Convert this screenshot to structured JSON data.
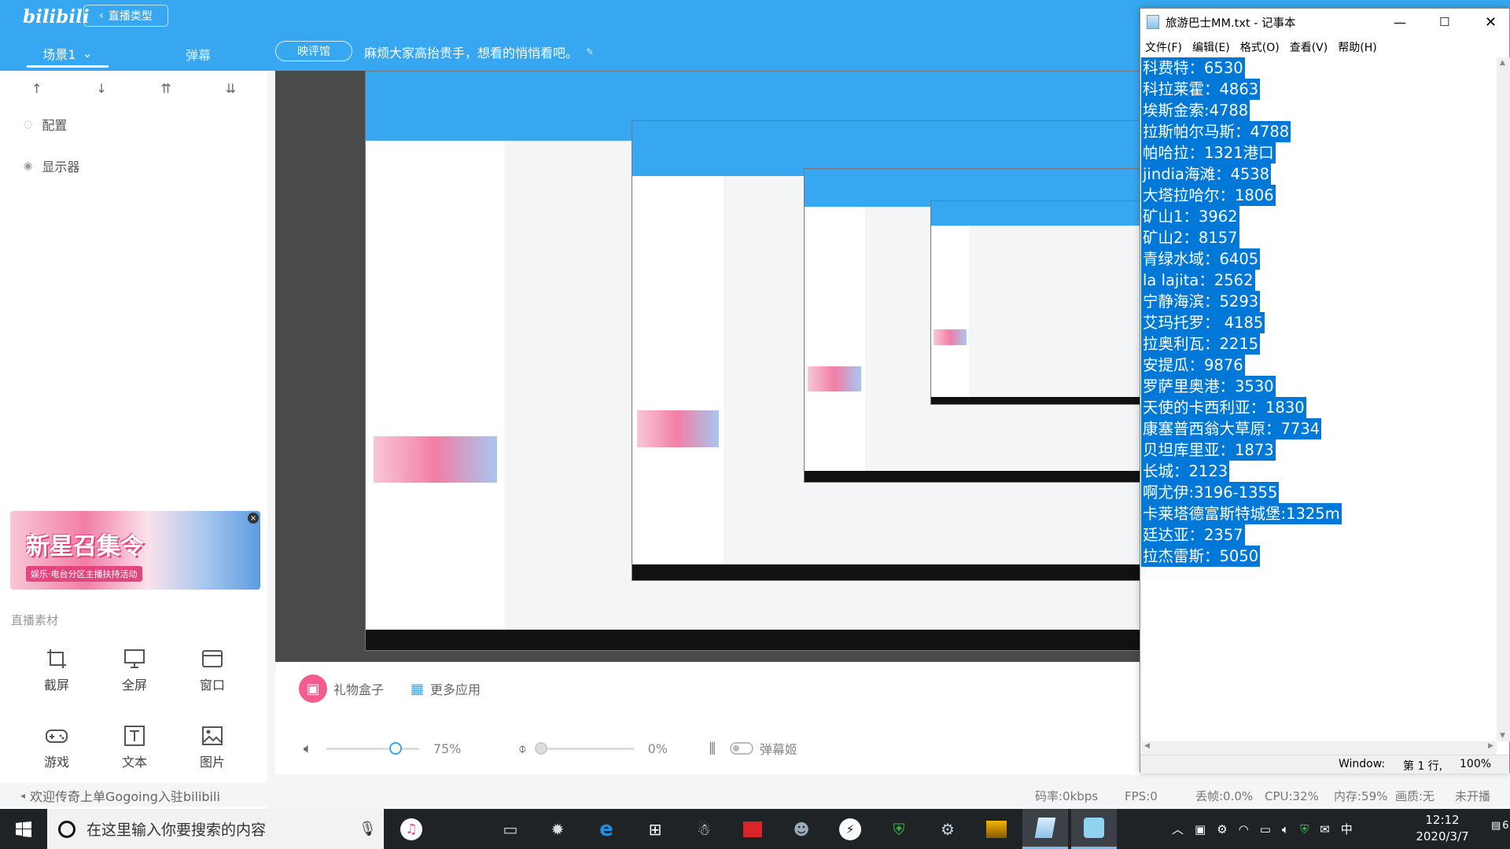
{
  "app": {
    "logo": "bilibili",
    "live_type_btn": "直播类型",
    "scene_tab": "场景1",
    "danmaku_tab": "弹幕",
    "review_btn": "映评馆",
    "notice": "麻烦大家高抬贵手，想看的悄悄看吧。"
  },
  "sidebar": {
    "items": [
      {
        "label": "配置",
        "icon": "eye-off-icon"
      },
      {
        "label": "显示器",
        "icon": "eye-icon"
      }
    ],
    "banner_title": "新星召集令",
    "banner_sub": "娱乐·电台分区主播扶持活动",
    "assets_title": "直播素材",
    "assets": [
      {
        "label": "截屏",
        "icon": "crop-icon"
      },
      {
        "label": "全屏",
        "icon": "monitor-icon"
      },
      {
        "label": "窗口",
        "icon": "window-icon"
      },
      {
        "label": "游戏",
        "icon": "gamepad-icon"
      },
      {
        "label": "文本",
        "icon": "text-icon"
      },
      {
        "label": "图片",
        "icon": "image-icon"
      }
    ]
  },
  "controls": {
    "gift_box": "礼物盒子",
    "more_apps": "更多应用",
    "volume": "75%",
    "volume_level": 0.75,
    "mic": "0%",
    "mic_level": 0.0,
    "danmaku_girl": "弹幕姬"
  },
  "statusbar": {
    "welcome": "欢迎传奇上单Gogoing入驻bilibili",
    "bitrate": "码率:0kbps",
    "fps": "FPS:0",
    "dropped": "丢帧:0.0%",
    "cpu": "CPU:32%",
    "mem": "内存:59%",
    "quality": "画质:无",
    "live_state": "未开播"
  },
  "notepad": {
    "title": "旅游巴士MM.txt - 记事本",
    "menu": [
      "文件(F)",
      "编辑(E)",
      "格式(O)",
      "查看(V)",
      "帮助(H)"
    ],
    "lines": [
      "科费特：6530",
      "科拉莱霍：4863",
      "埃斯金索:4788",
      "拉斯帕尔马斯：4788",
      "帕哈拉：1321港口",
      "jindia海滩：4538",
      "大塔拉哈尔：1806",
      "矿山1：3962",
      "矿山2：8157",
      "青绿水域：6405",
      "la lajita：2562",
      "宁静海滨：5293",
      "艾玛托罗： 4185",
      "拉奥利瓦：2215",
      "安提瓜：9876",
      "罗萨里奥港：3530",
      "天使的卡西利亚：1830",
      "康塞普西翁大草原：7734",
      "贝坦库里亚：1873",
      "长城：2123",
      "啊尤伊:3196-1355",
      "卡莱塔德富斯特城堡:1325m",
      "廷达亚：2357",
      "拉杰雷斯：5050"
    ],
    "status_enc": "Window:",
    "status_pos": "第 1 行,",
    "status_zoom": "100%"
  },
  "taskbar": {
    "search_placeholder": "在这里输入你要搜索的内容",
    "time": "12:12",
    "date": "2020/3/7",
    "notification_count": "6",
    "ime": "中"
  }
}
